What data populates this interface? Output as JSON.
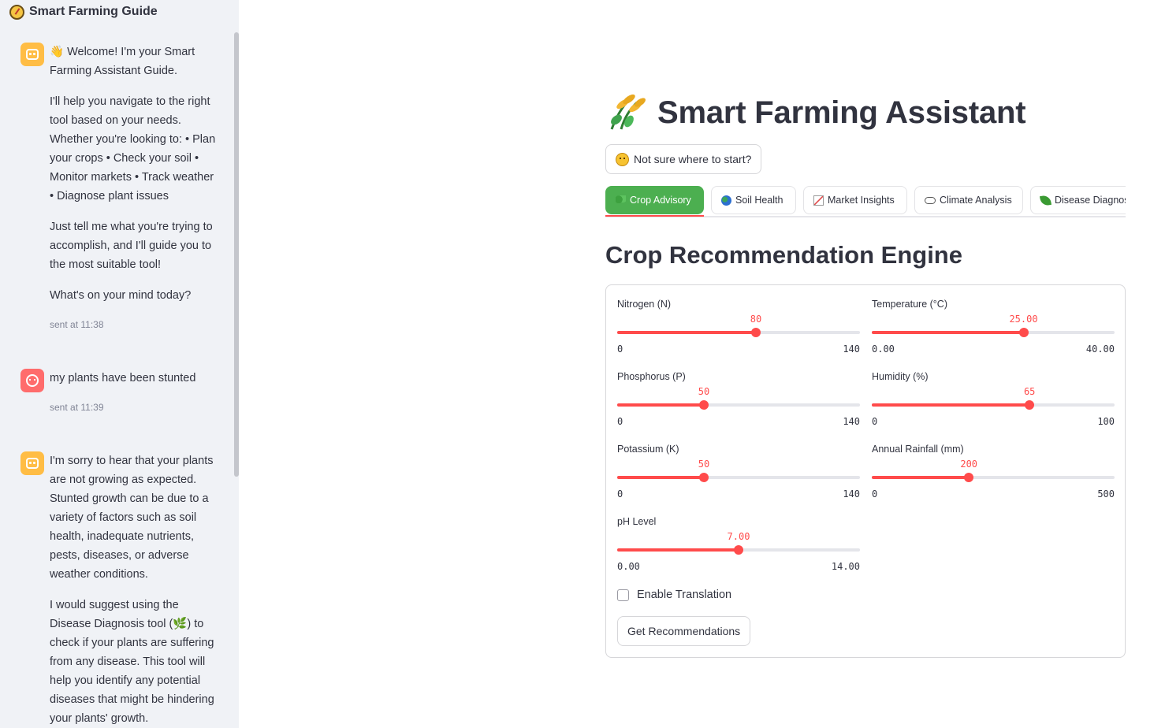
{
  "sidebar": {
    "title": "Smart Farming Guide",
    "messages": [
      {
        "role": "assistant",
        "paragraphs": [
          "👋 Welcome! I'm your Smart Farming Assistant Guide.",
          "I'll help you navigate to the right tool based on your needs. Whether you're looking to: • Plan your crops • Check your soil • Monitor markets • Track weather • Diagnose plant issues",
          "Just tell me what you're trying to accomplish, and I'll guide you to the most suitable tool!",
          "What's on your mind today?"
        ],
        "timestamp": "sent at 11:38"
      },
      {
        "role": "user",
        "paragraphs": [
          "my plants have been stunted"
        ],
        "timestamp": "sent at 11:39"
      },
      {
        "role": "assistant",
        "paragraphs": [
          "I'm sorry to hear that your plants are not growing as expected. Stunted growth can be due to a variety of factors such as soil health, inadequate nutrients, pests, diseases, or adverse weather conditions.",
          "I would suggest using the Disease Diagnosis tool (🌿) to check if your plants are suffering from any disease. This tool will help you identify any potential diseases that might be hindering your plants' growth."
        ]
      }
    ]
  },
  "header": {
    "title": "Smart Farming Assistant",
    "help_button": "Not sure where to start?"
  },
  "tabs": [
    {
      "label": "Crop Advisory",
      "icon": "sprout-icon",
      "active": true
    },
    {
      "label": "Soil Health",
      "icon": "globe-icon",
      "active": false
    },
    {
      "label": "Market Insights",
      "icon": "chart-icon",
      "active": false
    },
    {
      "label": "Climate Analysis",
      "icon": "cloud-icon",
      "active": false
    },
    {
      "label": "Disease Diagnosis",
      "icon": "leaf-icon",
      "active": false
    }
  ],
  "section_title": "Crop Recommendation Engine",
  "sliders": [
    {
      "id": "nitrogen",
      "label": "Nitrogen (N)",
      "value": 80,
      "min": 0,
      "max": 140,
      "display_value": "80",
      "display_min": "0",
      "display_max": "140"
    },
    {
      "id": "temperature",
      "label": "Temperature (°C)",
      "value": 25,
      "min": 0,
      "max": 40,
      "display_value": "25.00",
      "display_min": "0.00",
      "display_max": "40.00"
    },
    {
      "id": "phosphorus",
      "label": "Phosphorus (P)",
      "value": 50,
      "min": 0,
      "max": 140,
      "display_value": "50",
      "display_min": "0",
      "display_max": "140"
    },
    {
      "id": "humidity",
      "label": "Humidity (%)",
      "value": 65,
      "min": 0,
      "max": 100,
      "display_value": "65",
      "display_min": "0",
      "display_max": "100"
    },
    {
      "id": "potassium",
      "label": "Potassium (K)",
      "value": 50,
      "min": 0,
      "max": 140,
      "display_value": "50",
      "display_min": "0",
      "display_max": "140"
    },
    {
      "id": "rainfall",
      "label": "Annual Rainfall (mm)",
      "value": 200,
      "min": 0,
      "max": 500,
      "display_value": "200",
      "display_min": "0",
      "display_max": "500"
    },
    {
      "id": "ph",
      "label": "pH Level",
      "value": 7,
      "min": 0,
      "max": 14,
      "display_value": "7.00",
      "display_min": "0.00",
      "display_max": "14.00"
    }
  ],
  "translation_checkbox": {
    "label": "Enable Translation",
    "checked": false
  },
  "submit_button": "Get Recommendations",
  "colors": {
    "accent": "#ff4b4b",
    "active_tab": "#4caf50",
    "sidebar_bg": "#f0f2f6"
  }
}
